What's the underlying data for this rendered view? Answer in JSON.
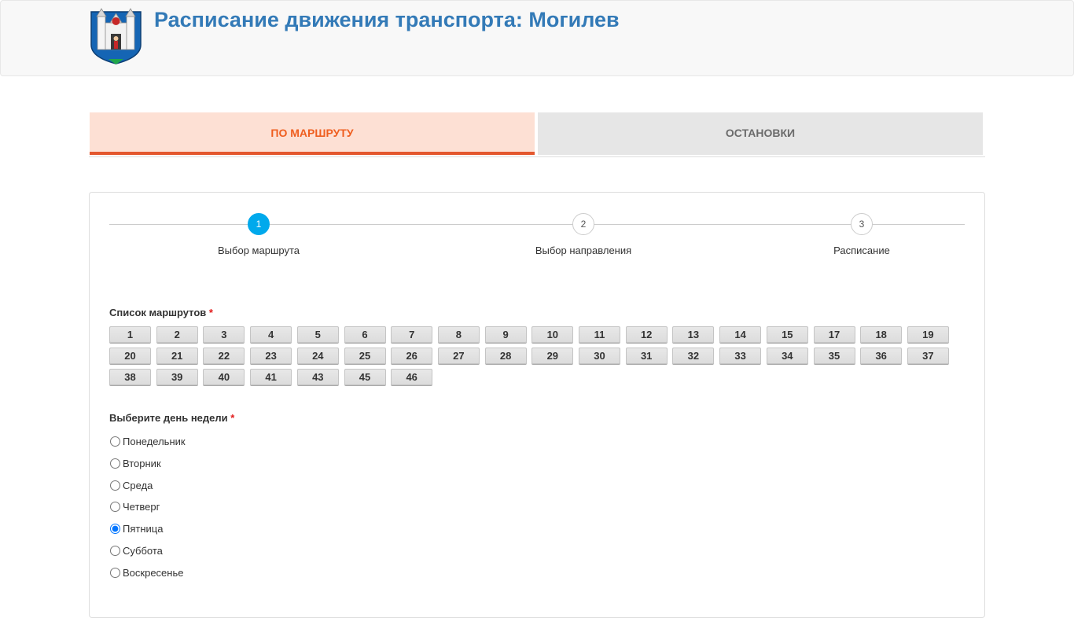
{
  "header": {
    "title": "Расписание движения транспорта: Могилев"
  },
  "colors": {
    "title": "#337ab7",
    "active_tab_bg": "#fde0d4",
    "active_tab_text": "#ef5e1f",
    "active_tab_border": "#e4572e",
    "inactive_tab_bg": "#e6e6e6",
    "active_step": "#00a9ec",
    "required_marker": "#e21b1b"
  },
  "tabs": [
    {
      "label": "ПО МАРШРУТУ",
      "active": true
    },
    {
      "label": "ОСТАНОВКИ",
      "active": false
    }
  ],
  "steps": [
    {
      "number": "1",
      "label": "Выбор маршрута",
      "active": true
    },
    {
      "number": "2",
      "label": "Выбор направления",
      "active": false
    },
    {
      "number": "3",
      "label": "Расписание",
      "active": false
    }
  ],
  "routes": {
    "title": "Список маршрутов",
    "required_mark": "*",
    "items": [
      "1",
      "2",
      "3",
      "4",
      "5",
      "6",
      "7",
      "8",
      "9",
      "10",
      "11",
      "12",
      "13",
      "14",
      "15",
      "17",
      "18",
      "19",
      "20",
      "21",
      "22",
      "23",
      "24",
      "25",
      "26",
      "27",
      "28",
      "29",
      "30",
      "31",
      "32",
      "33",
      "34",
      "35",
      "36",
      "37",
      "38",
      "39",
      "40",
      "41",
      "43",
      "45",
      "46"
    ]
  },
  "days": {
    "title": "Выберите день недели",
    "required_mark": "*",
    "items": [
      "Понедельник",
      "Вторник",
      "Среда",
      "Четверг",
      "Пятница",
      "Суббота",
      "Воскресенье"
    ],
    "selected": "Пятница"
  }
}
